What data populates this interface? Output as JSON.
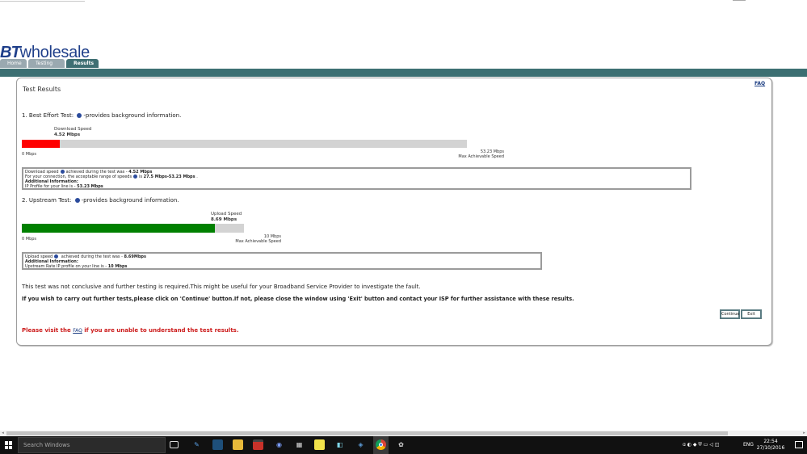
{
  "header": {
    "logo_bt": "BT",
    "logo_wholesale": "wholesale",
    "tabs": [
      {
        "label": "Home"
      },
      {
        "label": "Testing"
      },
      {
        "label": "Results"
      }
    ]
  },
  "panel": {
    "title": "Test Results",
    "faq_label": "FAQ",
    "best_effort": {
      "heading_prefix": "1. Best Effort Test:",
      "heading_suffix": "-provides background information.",
      "bar_label": "Download Speed",
      "bar_value": "4.52 Mbps",
      "axis_min": "0 Mbps",
      "axis_max_value": "53.23 Mbps",
      "axis_max_label": "Max Achievable Speed",
      "fill_fraction": 0.0849,
      "fill_color": "#ff0000",
      "details": {
        "line1_prefix": "Download speed",
        "line1_mid": "achieved during the test was - ",
        "line1_value": "4.52 Mbps",
        "line2_prefix": "For your connection, the acceptable range of speeds",
        "line2_mid": "is ",
        "line2_value": "27.5 Mbps-53.23 Mbps",
        "line2_suffix": " .",
        "line3": "Additional Information:",
        "line4_prefix": "IP Profile for your line is - ",
        "line4_value": "53.23 Mbps"
      }
    },
    "upstream": {
      "heading_prefix": "2. Upstream Test:",
      "heading_suffix": "-provides background information.",
      "bar_label": "Upload Speed",
      "bar_value": "8.69 Mbps",
      "axis_min": "0 Mbps",
      "axis_max_value": "10 Mbps",
      "axis_max_label": "Max Achievable Speed",
      "fill_fraction": 0.869,
      "fill_color": "#008000",
      "details": {
        "line1_prefix": "Upload speed",
        "line1_mid": " achieved during the test was - ",
        "line1_value": "8.69Mbps",
        "line2": "Additional Information:",
        "line3_prefix": "Upstream Rate IP profile on your line is - ",
        "line3_value": "10 Mbps"
      }
    },
    "message1": "This test was not conclusive and further testing is required.This might be useful for your Broadband Service Provider to investigate the fault.",
    "message2": "If you wish to carry out further tests,please click on 'Continue' button.If not, please close the window using 'Exit' button and contact your ISP for further assistance with these results.",
    "continue_label": "Continue",
    "exit_label": "Exit",
    "visit_prefix": "Please visit the ",
    "visit_link": "FAQ",
    "visit_suffix": " if you are unable to understand the test results."
  },
  "taskbar": {
    "search_placeholder": "Search Windows",
    "language": "ENG",
    "time": "22:54",
    "date": "27/10/2016"
  }
}
